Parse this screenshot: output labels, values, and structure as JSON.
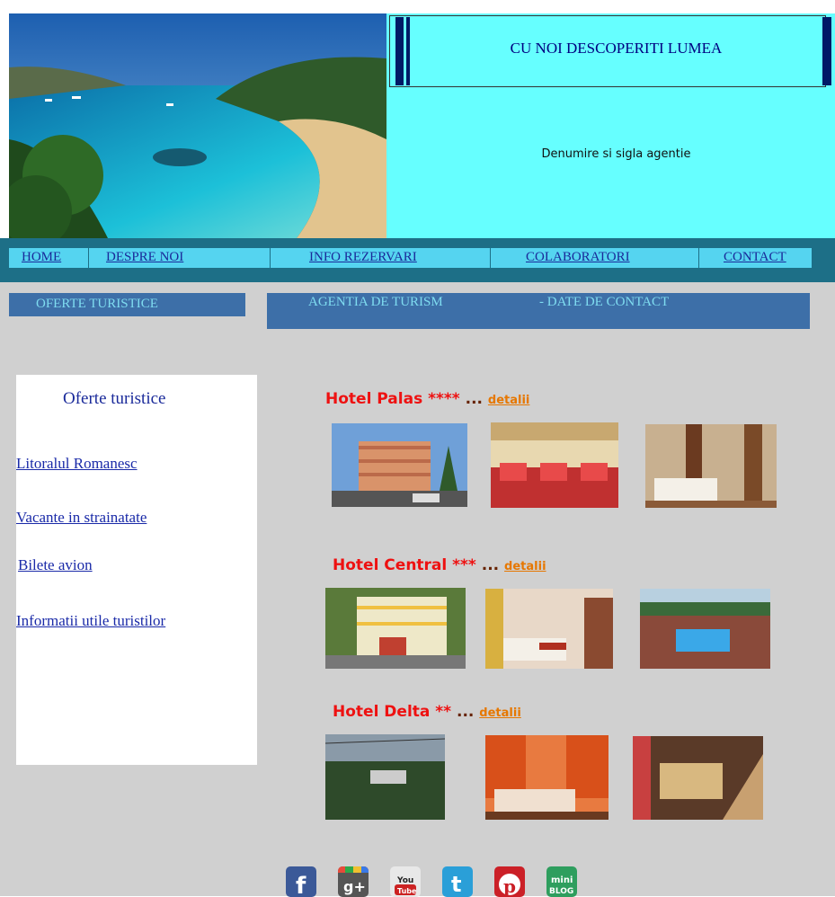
{
  "header": {
    "title": "CU NOI DESCOPERITI LUMEA",
    "agency": "Denumire si sigla agentie"
  },
  "nav": {
    "home": "HOME",
    "about": "DESPRE NOI",
    "reservations": "INFO REZERVARI",
    "collaborators": "COLABORATORI",
    "contact": "CONTACT"
  },
  "sections": {
    "offers": "OFERTE TURISTICE",
    "agency": "AGENTIA DE TURISM",
    "contact": "- DATE DE CONTACT"
  },
  "sidebar": {
    "title": "Oferte turistice",
    "links": [
      "Litoralul Romanesc",
      "Vacante in strainatate",
      "Bilete avion",
      "Informatii utile turistilor"
    ]
  },
  "hotels": [
    {
      "name": "Hotel Palas ****",
      "dots": " ...",
      "link": "detalii"
    },
    {
      "name": "Hotel Central ***",
      "dots": " ...",
      "link": "detalii"
    },
    {
      "name": "Hotel Delta **",
      "dots": " ...",
      "link": "detalii"
    }
  ],
  "social": [
    {
      "icon": "facebook-icon",
      "label": "f",
      "color": "#3b5998"
    },
    {
      "icon": "google-plus-icon",
      "label": "g+",
      "color": "#444444"
    },
    {
      "icon": "youtube-icon",
      "label": "You Tube",
      "color": "#cc2222"
    },
    {
      "icon": "twitter-icon",
      "label": "t",
      "color": "#2a9fd8"
    },
    {
      "icon": "pinterest-icon",
      "label": "p",
      "color": "#cb2027"
    },
    {
      "icon": "miniblog-icon",
      "label": "mini BLOG",
      "color": "#2e9e5e"
    }
  ]
}
